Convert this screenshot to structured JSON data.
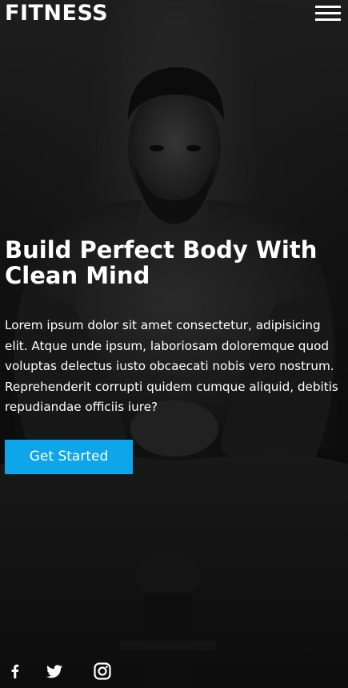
{
  "header": {
    "brand": "FITNESS",
    "menu_icon": "hamburger-menu-icon"
  },
  "hero": {
    "title": "Build Perfect Body With Clean Mind",
    "description": "Lorem ipsum dolor sit amet consectetur, adipisicing elit. Atque unde ipsum, laboriosam doloremque quod voluptas delectus iusto obcaecati nobis vero nostrum. Reprehenderit corrupti quidem cumque aliquid, debitis repudiandae officiis iure?",
    "cta_label": "Get Started",
    "cta_color": "#0ea5ea",
    "background_image": "dark-muscular-man-seated-photo"
  },
  "social": [
    {
      "icon": "facebook-icon"
    },
    {
      "icon": "twitter-icon"
    },
    {
      "icon": "instagram-icon"
    }
  ]
}
